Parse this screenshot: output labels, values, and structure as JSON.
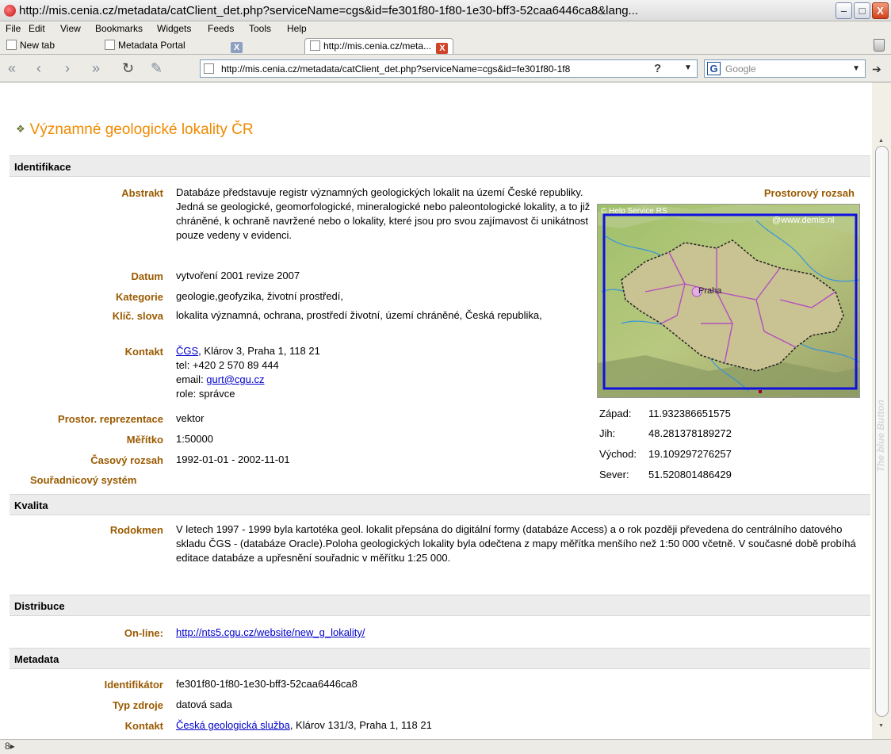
{
  "window": {
    "title": "http://mis.cenia.cz/metadata/catClient_det.php?serviceName=cgs&id=fe301f80-1f80-1e30-bff3-52caa6446ca8&lang...",
    "min": "–",
    "max": "□",
    "close": "X"
  },
  "menu": [
    "File",
    "Edit",
    "View",
    "Bookmarks",
    "Widgets",
    "Feeds",
    "Tools",
    "Help"
  ],
  "tabs": {
    "newtab": "New tab",
    "portal": "Metadata Portal",
    "active": "http://mis.cenia.cz/meta...",
    "close": "X"
  },
  "nav": {
    "back_all": "«",
    "back": "‹",
    "forward": "›",
    "forward_all": "»",
    "reload": "↻",
    "edit": "✎",
    "url": "http://mis.cenia.cz/metadata/catClient_det.php?serviceName=cgs&id=fe301f80-1f8",
    "help": "?",
    "dropdown": "▼",
    "search_logo": "G",
    "search_placeholder": "Google",
    "go": "➔"
  },
  "page": {
    "title_icon": "❖",
    "title": "Významné geologické lokality ČR",
    "sections": {
      "identifikace": "Identifikace",
      "kvalita": "Kvalita",
      "distribuce": "Distribuce",
      "metadata": "Metadata"
    },
    "ident": {
      "abstrakt_label": "Abstrakt",
      "abstrakt": "Databáze představuje registr významných geologických lokalit na území České republiky. Jedná se geologické, geomorfologické, mineralogické nebo paleontologické lokality, a to již chráněné, k ochraně navržené nebo o lokality, které jsou pro svou zajímavost či unikátnost pouze vedeny v evidenci.",
      "datum_label": "Datum",
      "datum": "vytvoření 2001 revize 2007",
      "kategorie_label": "Kategorie",
      "kategorie": "geologie,geofyzika, životní prostředí,",
      "klic_label": "Klíč. slova",
      "klic": "lokalita významná, ochrana, prostředí životní, území chráněné, Česká republika,",
      "kontakt_label": "Kontakt",
      "kontakt_link": "ČGS",
      "kontakt_addr": ", Klárov 3, Praha 1, 118 21",
      "kontakt_tel": "tel: +420 2 570 89 444",
      "kontakt_email_prefix": "email: ",
      "kontakt_email": "gurt@cgu.cz",
      "kontakt_role": "role: správce",
      "prostor_label": "Prostor. reprezentace",
      "prostor": "vektor",
      "meritko_label": "Měřítko",
      "meritko": "1:50000",
      "casovy_label": "Časový rozsah",
      "casovy": "1992-01-01 - 2002-11-01",
      "souradnicovy_label": "Souřadnicový systém",
      "rozsah_label": "Prostorový rozsah",
      "map_copy1": "© Help Service RS",
      "map_copy2": "@www.demis.nl",
      "map_city": "Praha"
    },
    "coords": {
      "zapad_label": "Západ:",
      "zapad": "11.932386651575",
      "jih_label": "Jih:",
      "jih": "48.281378189272",
      "vychod_label": "Východ:",
      "vychod": "19.109297276257",
      "sever_label": "Sever:",
      "sever": "51.520801486429"
    },
    "kvalita": {
      "rodokmen_label": "Rodokmen",
      "rodokmen": "V letech 1997 - 1999 byla kartotéka geol. lokalit přepsána do digitální formy (databáze Access) a o rok později převedena do centrálního datového skladu ČGS - (databáze Oracle).Poloha geologických lokality byla odečtena z mapy měřítka menšího než 1:50 000 včetně. V současné době probíhá editace databáze a upřesnění souřadnic v měřítku 1:25 000."
    },
    "distribuce": {
      "online_label": "On-line:",
      "online": "http://nts5.cgu.cz/website/new_g_lokality/"
    },
    "metadata": {
      "ident_label": "Identifikátor",
      "ident": "fe301f80-1f80-1e30-bff3-52caa6446ca8",
      "typ_label": "Typ zdroje",
      "typ": "datová sada",
      "kontakt_label": "Kontakt",
      "kontakt_link": "Česká geologická služba",
      "kontakt_addr": ", Klárov 131/3, Praha 1, 118 21"
    }
  },
  "scrollbar": {
    "vertical_text": "The blue Button"
  },
  "status": {
    "icon": "8▸"
  }
}
